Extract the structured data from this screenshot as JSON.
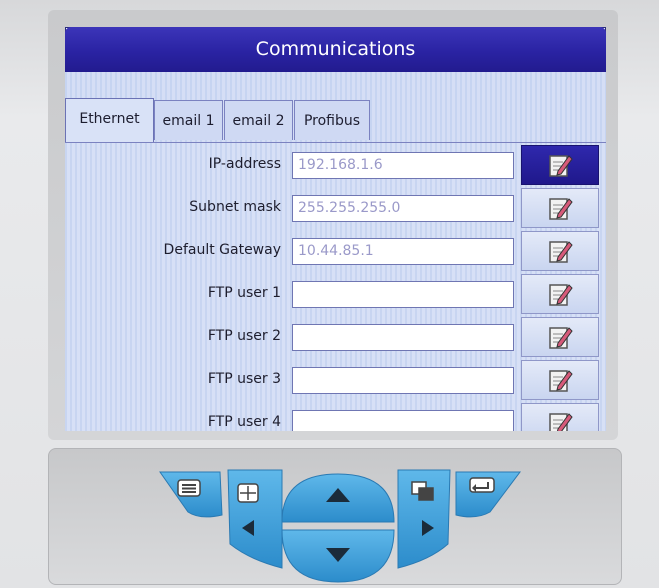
{
  "window": {
    "title": "Communications"
  },
  "tabs": [
    {
      "label": "Ethernet",
      "active": true
    },
    {
      "label": "email 1",
      "active": false
    },
    {
      "label": "email 2",
      "active": false
    },
    {
      "label": "Profibus",
      "active": false
    }
  ],
  "fields": [
    {
      "label": "IP-address",
      "value": "192.168.1.6"
    },
    {
      "label": "Subnet mask",
      "value": "255.255.255.0"
    },
    {
      "label": "Default Gateway",
      "value": "10.44.85.1"
    },
    {
      "label": "FTP user 1",
      "value": ""
    },
    {
      "label": "FTP user 2",
      "value": ""
    },
    {
      "label": "FTP user 3",
      "value": ""
    },
    {
      "label": "FTP user 4",
      "value": ""
    }
  ],
  "colors": {
    "title_bar": "#2a23a3",
    "field_text": "#9a99c9",
    "key_blue": "#3b9fd6",
    "selected_edit": "#2f28ad"
  },
  "icons": {
    "edit": "edit-note-icon",
    "keys": [
      "menu-icon",
      "grid-icon",
      "arrow-up-icon",
      "arrow-left-icon",
      "arrow-down-icon",
      "arrow-right-icon",
      "window-icon",
      "return-icon"
    ]
  }
}
